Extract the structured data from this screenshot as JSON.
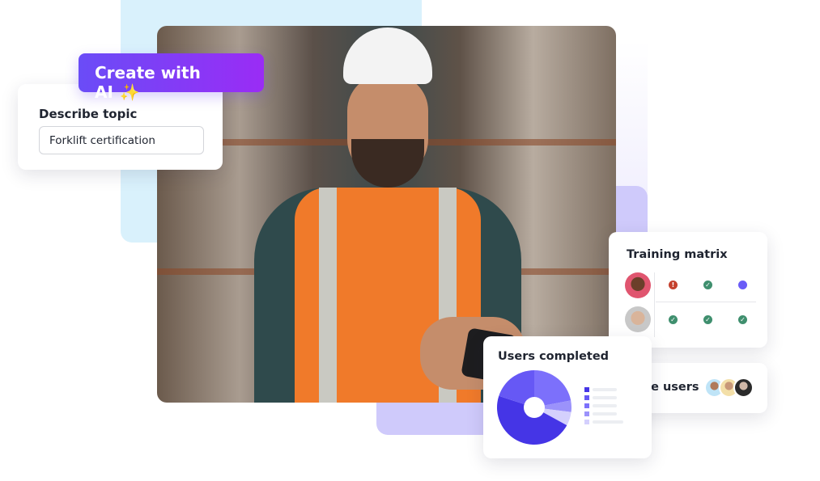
{
  "ai_button": {
    "label": "Create with AI",
    "icon": "sparkles-icon"
  },
  "topic_card": {
    "label": "Describe topic",
    "input_value": "Forklift certification"
  },
  "training_matrix": {
    "title": "Training matrix",
    "rows": [
      {
        "avatar": "woman-avatar",
        "statuses": [
          "error",
          "complete",
          "in-progress"
        ]
      },
      {
        "avatar": "man-avatar",
        "statuses": [
          "complete",
          "complete",
          "complete"
        ]
      }
    ]
  },
  "invite": {
    "label": "Invite users",
    "avatars": [
      "man-beard-avatar",
      "woman-curly-avatar",
      "woman-dark-avatar"
    ]
  },
  "users_completed": {
    "title": "Users completed",
    "chart_data": {
      "type": "pie",
      "values": [
        22,
        5,
        6,
        47,
        20
      ],
      "colors": [
        "#7c70fb",
        "#9b92fb",
        "#d4d0fd",
        "#4535e6",
        "#6658f5"
      ]
    }
  },
  "colors": {
    "accent": "#6a4cf7",
    "accent2": "#9a2cf5",
    "success": "#3f8f6e",
    "error": "#c5412e"
  }
}
